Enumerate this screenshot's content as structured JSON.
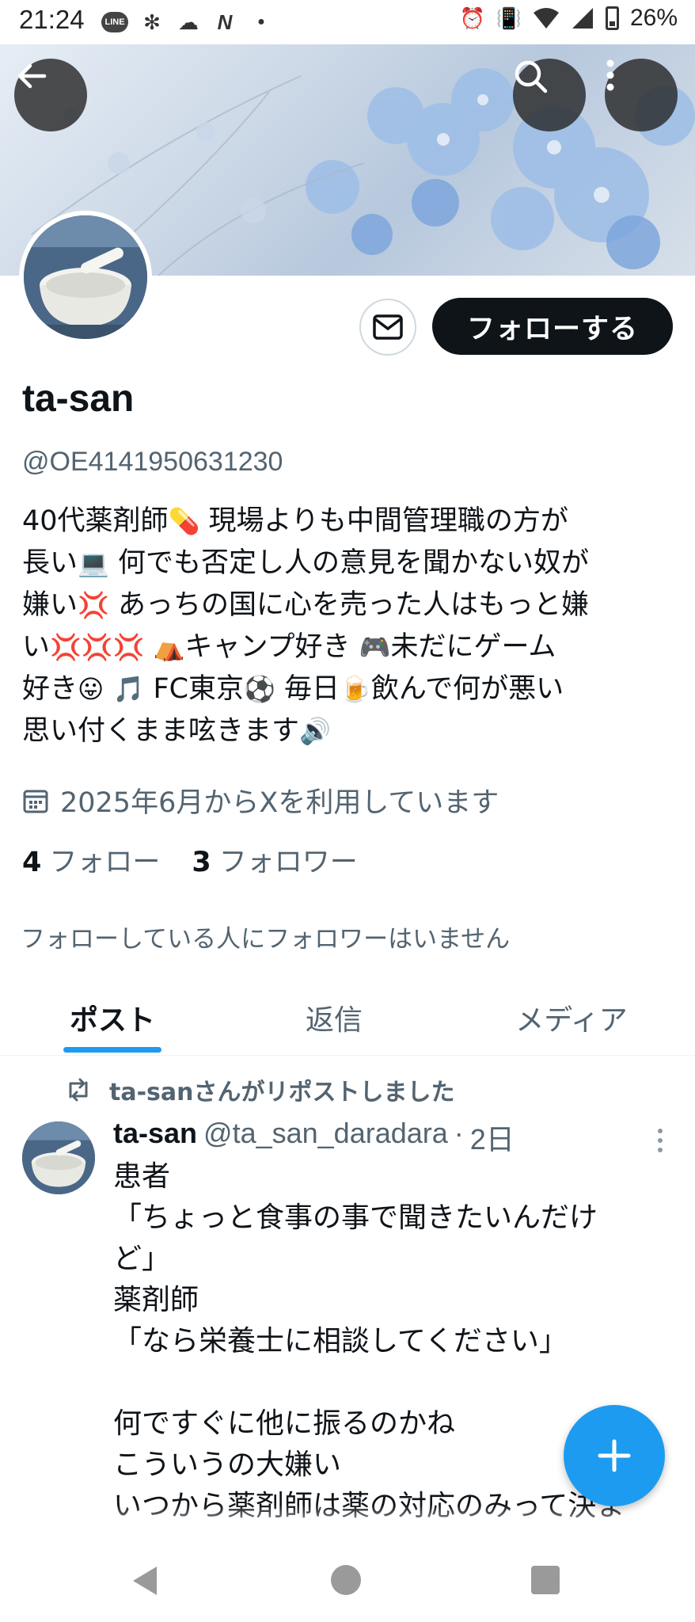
{
  "status_bar": {
    "time": "21:24",
    "line_badge": "LINE",
    "battery": "26%"
  },
  "profile": {
    "display_name": "ta-san",
    "handle": "@OE4141950631230",
    "follow_button": "フォローする",
    "bio_lines": [
      [
        "40代薬剤師",
        "💊",
        " 現場よりも中間管理職の方が"
      ],
      [
        "長い",
        "💻",
        " 何でも否定し人の意見を聞かない奴が"
      ],
      [
        "嫌い",
        "💢",
        " あっちの国に心を売った人はもっと嫌"
      ],
      [
        "い",
        "💢💢💢",
        " ",
        "⛺",
        "キャンプ好き ",
        "🎮",
        "未だにゲーム"
      ],
      [
        "好き",
        "😛",
        " ",
        "🎵",
        " FC東京",
        "⚽",
        " 毎日",
        "🍺",
        "飲んで何が悪い"
      ],
      [
        "思い付くまま呟きます",
        "🔊"
      ]
    ],
    "joined": "2025年6月からXを利用しています",
    "following_count": "4",
    "following_label": "フォロー",
    "followers_count": "3",
    "followers_label": "フォロワー",
    "no_mutual": "フォローしている人にフォロワーはいません"
  },
  "tabs": [
    {
      "label": "ポスト",
      "active": true
    },
    {
      "label": "返信",
      "active": false
    },
    {
      "label": "メディア",
      "active": false
    }
  ],
  "post": {
    "repost_label": "ta-sanさんがリポストしました",
    "author_name": "ta-san",
    "author_handle": "@ta_san_daradara",
    "separator": "·",
    "age": "2日",
    "lines": [
      "患者",
      "「ちょっと食事の事で聞きたいんだけ",
      "ど」",
      "薬剤師",
      "「なら栄養士に相談してください」",
      "",
      "何ですぐに他に振るのかね",
      "こういうの大嫌い",
      "いつから薬剤師は薬の対応のみって決ま"
    ]
  },
  "colors": {
    "accent": "#1d9bf0",
    "text_primary": "#0f1419",
    "text_secondary": "#536471"
  },
  "icons": [
    "back-arrow-icon",
    "search-icon",
    "more-vertical-icon",
    "mail-icon",
    "calendar-icon",
    "repost-icon",
    "plus-icon",
    "nav-back-icon",
    "nav-home-icon",
    "nav-recents-icon"
  ]
}
